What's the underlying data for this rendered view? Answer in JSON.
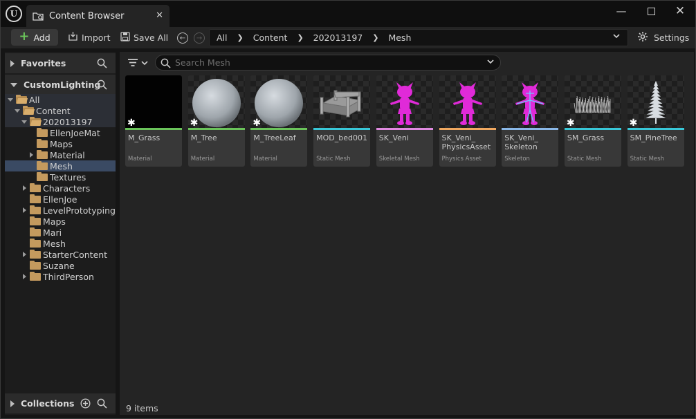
{
  "window": {
    "tab_title": "Content Browser",
    "logo_text": "U"
  },
  "toolbar": {
    "add_label": "Add",
    "import_label": "Import",
    "save_all_label": "Save All",
    "settings_label": "Settings",
    "breadcrumbs": [
      "All",
      "Content",
      "202013197",
      "Mesh"
    ]
  },
  "sidebar": {
    "favorites_label": "Favorites",
    "project_label": "CustomLighting",
    "collections_label": "Collections",
    "tree": [
      {
        "label": "All",
        "depth": 0,
        "expanded": true
      },
      {
        "label": "Content",
        "depth": 1,
        "expanded": true
      },
      {
        "label": "202013197",
        "depth": 2,
        "expanded": true
      },
      {
        "label": "EllenJoeMat",
        "depth": 3
      },
      {
        "label": "Maps",
        "depth": 3
      },
      {
        "label": "Material",
        "depth": 3,
        "collapsed": true
      },
      {
        "label": "Mesh",
        "depth": 3,
        "selected": true
      },
      {
        "label": "Textures",
        "depth": 3
      },
      {
        "label": "Characters",
        "depth": 2,
        "collapsed": true
      },
      {
        "label": "EllenJoe",
        "depth": 2
      },
      {
        "label": "LevelPrototyping",
        "depth": 2,
        "collapsed": true
      },
      {
        "label": "Maps",
        "depth": 2
      },
      {
        "label": "Mari",
        "depth": 2
      },
      {
        "label": "Mesh",
        "depth": 2
      },
      {
        "label": "StarterContent",
        "depth": 2,
        "collapsed": true
      },
      {
        "label": "Suzane",
        "depth": 2
      },
      {
        "label": "ThirdPerson",
        "depth": 2,
        "collapsed": true
      }
    ]
  },
  "search": {
    "placeholder": "Search Mesh"
  },
  "assets": [
    {
      "name": "M_Grass",
      "type": "Material",
      "bar_color": "#6ac35a",
      "thumb": "black",
      "modified": true
    },
    {
      "name": "M_Tree",
      "type": "Material",
      "bar_color": "#6ac35a",
      "thumb": "sphere",
      "modified": true
    },
    {
      "name": "M_TreeLeaf",
      "type": "Material",
      "bar_color": "#6ac35a",
      "thumb": "sphere",
      "modified": true
    },
    {
      "name": "MOD_bed001",
      "type": "Static Mesh",
      "bar_color": "#39c8d8",
      "thumb": "bed",
      "modified": false
    },
    {
      "name": "SK_Veni",
      "type": "Skeletal Mesh",
      "bar_color": "#e08ae0",
      "thumb": "character",
      "modified": false
    },
    {
      "name": "SK_Veni_ PhysicsAsset",
      "type": "Physics Asset",
      "bar_color": "#f0a860",
      "thumb": "character",
      "modified": false
    },
    {
      "name": "SK_Veni_ Skeleton",
      "type": "Skeleton",
      "bar_color": "#8ab8e8",
      "thumb": "skeleton",
      "modified": false
    },
    {
      "name": "SM_Grass",
      "type": "Static Mesh",
      "bar_color": "#39c8d8",
      "thumb": "grass",
      "modified": true
    },
    {
      "name": "SM_PineTree",
      "type": "Static Mesh",
      "bar_color": "#39c8d8",
      "thumb": "pine",
      "modified": true
    }
  ],
  "status": {
    "item_count": "9 items"
  }
}
